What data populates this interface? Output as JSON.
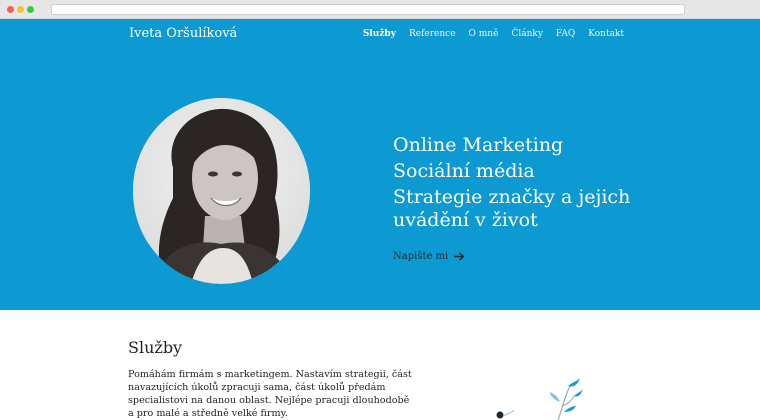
{
  "site": {
    "brand": "Iveta Oršulíková"
  },
  "nav": {
    "items": [
      {
        "label": "Služby",
        "active": true
      },
      {
        "label": "Reference",
        "active": false
      },
      {
        "label": "O mně",
        "active": false
      },
      {
        "label": "Články",
        "active": false
      },
      {
        "label": "FAQ",
        "active": false
      },
      {
        "label": "Kontakt",
        "active": false
      }
    ]
  },
  "hero": {
    "lines": [
      "Online Marketing",
      "Sociální média",
      "Strategie značky a jejich",
      "uvádění v život"
    ],
    "cta_label": "Napište mi",
    "cta_icon": "arrow-right-icon",
    "background": "#0d9ad2"
  },
  "services": {
    "title": "Služby",
    "body_lines": [
      "Pomáhám firmám s marketingem. Nastavím strategii, část",
      "navazujících úkolů zpracuji sama, část úkolů předám",
      "specialistovi na danou oblast. Nejlépe pracuji dlouhodobě",
      " a pro malé a středně velké firmy."
    ]
  },
  "colors": {
    "accent": "#0d9ad2",
    "text_dark": "#1f1f1f",
    "plant_blue": "#1a9bd6"
  }
}
